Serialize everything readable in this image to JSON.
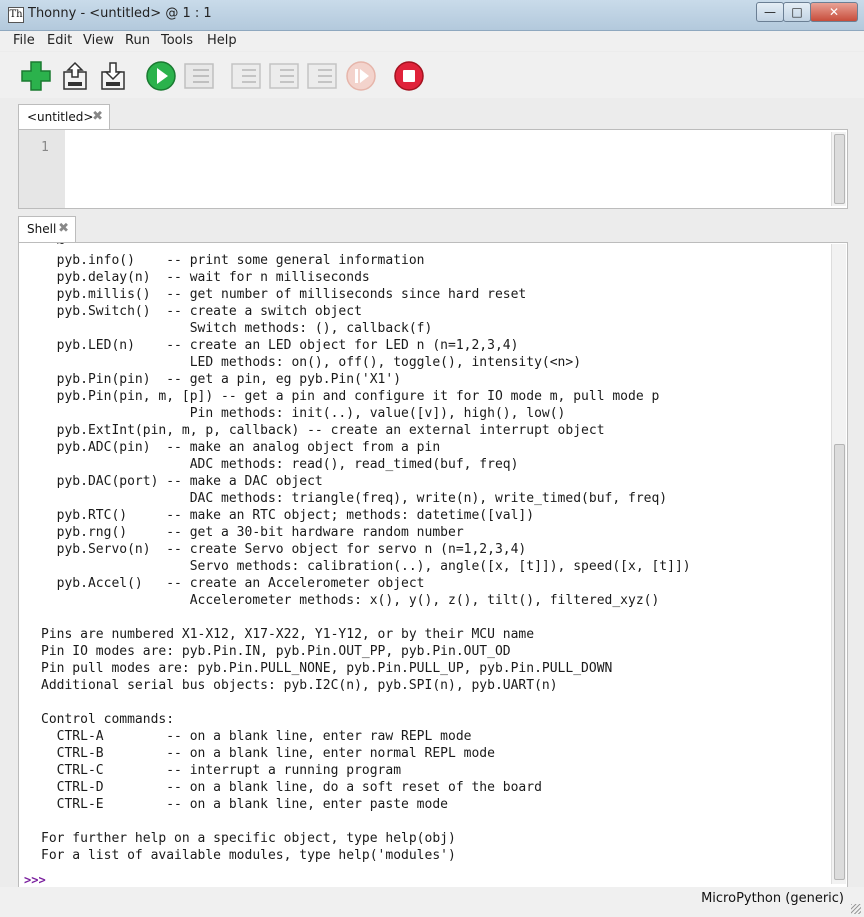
{
  "window": {
    "title": "Thonny  -  <untitled>  @  1 : 1",
    "minimize": "—",
    "maximize": "□",
    "close": "✕"
  },
  "menu": [
    "File",
    "Edit",
    "View",
    "Run",
    "Tools",
    "Help"
  ],
  "toolbar": {
    "buttons": [
      {
        "name": "new-file",
        "icon": "green-plus-icon"
      },
      {
        "name": "open-file",
        "icon": "open-folder-icon"
      },
      {
        "name": "save-file",
        "icon": "save-icon"
      },
      {
        "name": "run-current-script",
        "icon": "green-play-icon"
      },
      {
        "name": "debug-current-script",
        "icon": "debug-icon"
      },
      {
        "name": "step-over",
        "icon": "step-over-icon"
      },
      {
        "name": "step-into",
        "icon": "step-into-icon"
      },
      {
        "name": "step-out",
        "icon": "step-out-icon"
      },
      {
        "name": "resume",
        "icon": "resume-icon"
      },
      {
        "name": "stop",
        "icon": "red-stop-icon"
      }
    ],
    "colors": {
      "green": "#2bb24c",
      "red": "#e0223a",
      "disabled": "#bfbfbf"
    }
  },
  "editor": {
    "tab_label": "<untitled>",
    "tab_close": "✖",
    "line_number": "1"
  },
  "shell": {
    "tab_label": "Shell",
    "tab_close": "✖",
    "text": "  ~\n  pyb.info()    -- print some general information\n  pyb.delay(n)  -- wait for n milliseconds\n  pyb.millis()  -- get number of milliseconds since hard reset\n  pyb.Switch()  -- create a switch object\n                   Switch methods: (), callback(f)\n  pyb.LED(n)    -- create an LED object for LED n (n=1,2,3,4)\n                   LED methods: on(), off(), toggle(), intensity(<n>)\n  pyb.Pin(pin)  -- get a pin, eg pyb.Pin('X1')\n  pyb.Pin(pin, m, [p]) -- get a pin and configure it for IO mode m, pull mode p\n                   Pin methods: init(..), value([v]), high(), low()\n  pyb.ExtInt(pin, m, p, callback) -- create an external interrupt object\n  pyb.ADC(pin)  -- make an analog object from a pin\n                   ADC methods: read(), read_timed(buf, freq)\n  pyb.DAC(port) -- make a DAC object\n                   DAC methods: triangle(freq), write(n), write_timed(buf, freq)\n  pyb.RTC()     -- make an RTC object; methods: datetime([val])\n  pyb.rng()     -- get a 30-bit hardware random number\n  pyb.Servo(n)  -- create Servo object for servo n (n=1,2,3,4)\n                   Servo methods: calibration(..), angle([x, [t]]), speed([x, [t]])\n  pyb.Accel()   -- create an Accelerometer object\n                   Accelerometer methods: x(), y(), z(), tilt(), filtered_xyz()\n\nPins are numbered X1-X12, X17-X22, Y1-Y12, or by their MCU name\nPin IO modes are: pyb.Pin.IN, pyb.Pin.OUT_PP, pyb.Pin.OUT_OD\nPin pull modes are: pyb.Pin.PULL_NONE, pyb.Pin.PULL_UP, pyb.Pin.PULL_DOWN\nAdditional serial bus objects: pyb.I2C(n), pyb.SPI(n), pyb.UART(n)\n\nControl commands:\n  CTRL-A        -- on a blank line, enter raw REPL mode\n  CTRL-B        -- on a blank line, enter normal REPL mode\n  CTRL-C        -- interrupt a running program\n  CTRL-D        -- on a blank line, do a soft reset of the board\n  CTRL-E        -- on a blank line, enter paste mode\n\nFor further help on a specific object, type help(obj)\nFor a list of available modules, type help('modules')",
    "prompt": ">>>",
    "prompt_color": "#7a1f9e"
  },
  "status": {
    "interpreter": "MicroPython (generic)"
  }
}
